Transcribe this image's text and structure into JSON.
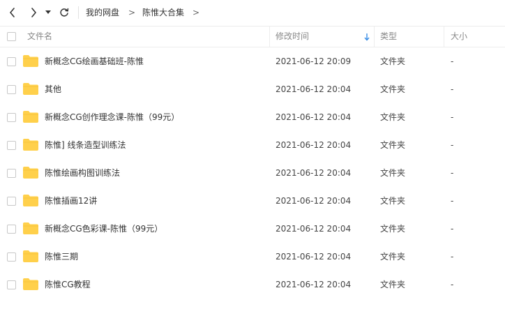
{
  "nav": {
    "back_icon": "chevron-left-icon",
    "forward_icon": "chevron-right-icon",
    "dropdown_icon": "caret-down-icon",
    "refresh_icon": "refresh-icon",
    "breadcrumb": [
      "我的网盘",
      "陈惟大合集"
    ],
    "separator": ">"
  },
  "table": {
    "columns": {
      "name": "文件名",
      "modified": "修改时间",
      "type": "类型",
      "size": "大小"
    },
    "sort_icon": "sort-down-arrow-icon",
    "accent_color": "#3a8ee6",
    "folder_color": "#ffd04b",
    "rows": [
      {
        "name": "新概念CG绘画基础班-陈惟",
        "modified": "2021-06-12 20:09",
        "type": "文件夹",
        "size": "-"
      },
      {
        "name": "其他",
        "modified": "2021-06-12 20:04",
        "type": "文件夹",
        "size": "-"
      },
      {
        "name": "新概念CG创作理念课-陈惟（99元）",
        "modified": "2021-06-12 20:04",
        "type": "文件夹",
        "size": "-"
      },
      {
        "name": "陈惟] 线条造型训练法",
        "modified": "2021-06-12 20:04",
        "type": "文件夹",
        "size": "-"
      },
      {
        "name": "陈惟绘画构图训练法",
        "modified": "2021-06-12 20:04",
        "type": "文件夹",
        "size": "-"
      },
      {
        "name": "陈惟插画12讲",
        "modified": "2021-06-12 20:04",
        "type": "文件夹",
        "size": "-"
      },
      {
        "name": "新概念CG色彩课-陈惟（99元）",
        "modified": "2021-06-12 20:04",
        "type": "文件夹",
        "size": "-"
      },
      {
        "name": "陈惟三期",
        "modified": "2021-06-12 20:04",
        "type": "文件夹",
        "size": "-"
      },
      {
        "name": "陈惟CG教程",
        "modified": "2021-06-12 20:04",
        "type": "文件夹",
        "size": "-"
      }
    ]
  }
}
